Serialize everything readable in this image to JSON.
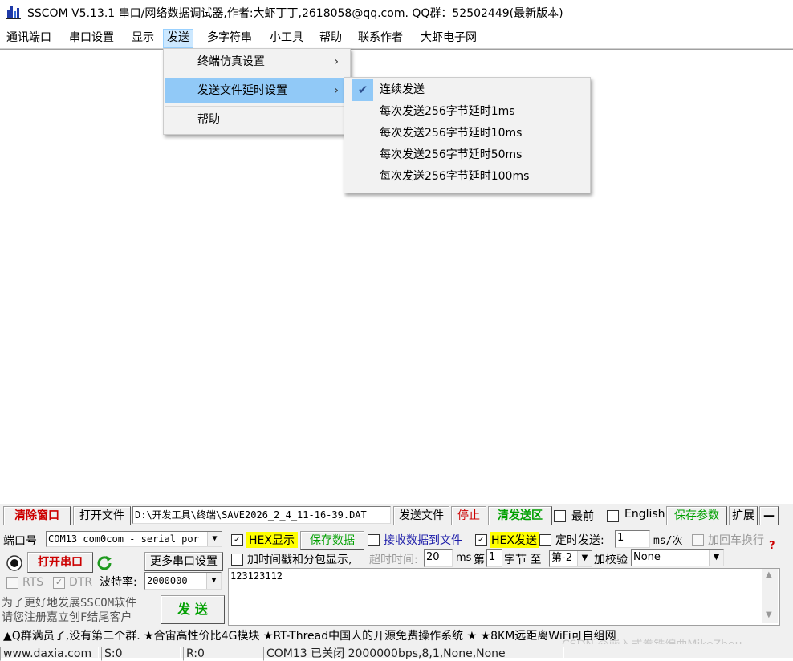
{
  "window": {
    "title": "SSCOM V5.13.1 串口/网络数据调试器,作者:大虾丁丁,2618058@qq.com. QQ群：52502449(最新版本)"
  },
  "menubar": {
    "items": [
      "通讯端口",
      "串口设置",
      "显示",
      "发送",
      "多字符串",
      "小工具",
      "帮助",
      "联系作者",
      "大虾电子网"
    ],
    "active_index": 3
  },
  "send_menu": {
    "items": [
      {
        "label": "终端仿真设置",
        "has_submenu": true
      },
      {
        "label": "发送文件延时设置",
        "has_submenu": true,
        "highlighted": true
      },
      {
        "label": "帮助",
        "has_submenu": false
      }
    ]
  },
  "delay_submenu": {
    "items": [
      {
        "label": "连续发送",
        "checked": true
      },
      {
        "label": "每次发送256字节延时1ms",
        "checked": false
      },
      {
        "label": "每次发送256字节延时10ms",
        "checked": false
      },
      {
        "label": "每次发送256字节延时50ms",
        "checked": false
      },
      {
        "label": "每次发送256字节延时100ms",
        "checked": false
      }
    ]
  },
  "toolbar1": {
    "clear_window": "清除窗口",
    "open_file": "打开文件",
    "file_path": "D:\\开发工具\\终端\\SAVE2026_2_4_11-16-39.DAT",
    "send_file": "发送文件",
    "stop": "停止",
    "clear_send": "清发送区",
    "topmost_label": "最前",
    "english_label": "English",
    "save_params": "保存参数",
    "expand": "扩展",
    "minus": "—"
  },
  "port_panel": {
    "port_label": "端口号",
    "port_value": "COM13 com0com - serial por",
    "open_port": "打开串口",
    "more_settings": "更多串口设置",
    "rts_label": "RTS",
    "dtr_label": "DTR",
    "baud_label": "波特率:",
    "baud_value": "2000000",
    "promo_line1": "为了更好地发展SSCOM软件",
    "promo_line2": "请您注册嘉立创F结尾客户",
    "send_button": "发 送"
  },
  "options_row1": {
    "hex_display": "HEX显示",
    "save_data": "保存数据",
    "recv_to_file": "接收数据到文件",
    "hex_send": "HEX发送",
    "timed_send": "定时发送:",
    "interval_value": "1",
    "interval_unit": "ms/次",
    "add_crlf": "加回车换行"
  },
  "options_row2": {
    "timestamp": "加时间戳和分包显示,",
    "timeout_label": "超时时间:",
    "timeout_value": "20",
    "timeout_unit": "ms",
    "byte_prefix": "第",
    "byte_start": "1",
    "byte_mid": "字节 至",
    "byte_end": "第-2",
    "checksum_label": "加校验",
    "checksum_value": "None"
  },
  "send_text": "123123112",
  "ticker": "▲Q群满员了,没有第二个群. ★合宙高性价比4G模块 ★RT-Thread中国人的开源免费操作系统 ★ ★8KM远距离WiFi可自组网",
  "statusbar": {
    "website": "www.daxia.com",
    "sent": "S:0",
    "received": "R:0",
    "port_status": "COM13 已关闭  2000000bps,8,1,None,None"
  },
  "watermark": "CSDN @嵌入式拳铁编曲MikeZhou",
  "colors": {
    "menu_highlight": "#91c9f7",
    "menubar_active": "#cce8ff",
    "panel_bg": "#f0f0f0",
    "red_text": "#cc0000",
    "green_text": "#00a000",
    "hex_highlight": "#ffff00"
  },
  "icons": [
    "app-icon",
    "chevron-right-icon",
    "checkmark-icon",
    "record-icon",
    "refresh-icon",
    "question-icon",
    "dropdown-arrow-icon",
    "scroll-up-icon",
    "scroll-down-icon"
  ]
}
